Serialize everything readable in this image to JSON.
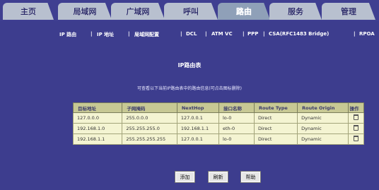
{
  "tabs": [
    {
      "label": "主页"
    },
    {
      "label": "局域网"
    },
    {
      "label": "广域网"
    },
    {
      "label": "呼叫"
    },
    {
      "label": "路由"
    },
    {
      "label": "服务"
    },
    {
      "label": "管理"
    }
  ],
  "subnav": [
    {
      "label": "IP 路由"
    },
    {
      "label": "IP 地址"
    },
    {
      "label": "局域网配置"
    },
    {
      "label": "DCL"
    },
    {
      "label": "ATM VC"
    },
    {
      "label": "PPP"
    },
    {
      "label": "CSA(RFC1483 Bridge)"
    },
    {
      "label": "RPOA"
    }
  ],
  "page": {
    "title": "IP路由表",
    "hint": "可查看以下当前IP路由表中的路由信息(可点击图标删除)"
  },
  "table": {
    "headers": [
      "目标地址",
      "子网掩码",
      "NextHop",
      "接口名称",
      "Route Type",
      "Route Origin",
      "操作"
    ],
    "rows": [
      [
        "127.0.0.0",
        "255.0.0.0",
        "127.0.0.1",
        "lo-0",
        "Direct",
        "Dynamic",
        ""
      ],
      [
        "192.168.1.0",
        "255.255.255.0",
        "192.168.1.1",
        "eth-0",
        "Direct",
        "Dynamic",
        ""
      ],
      [
        "192.168.1.1",
        "255.255.255.255",
        "127.0.0.1",
        "lo-0",
        "Direct",
        "Dynamic",
        ""
      ]
    ]
  },
  "buttons": [
    {
      "label": "添加"
    },
    {
      "label": "刷新"
    },
    {
      "label": "帮助"
    }
  ]
}
